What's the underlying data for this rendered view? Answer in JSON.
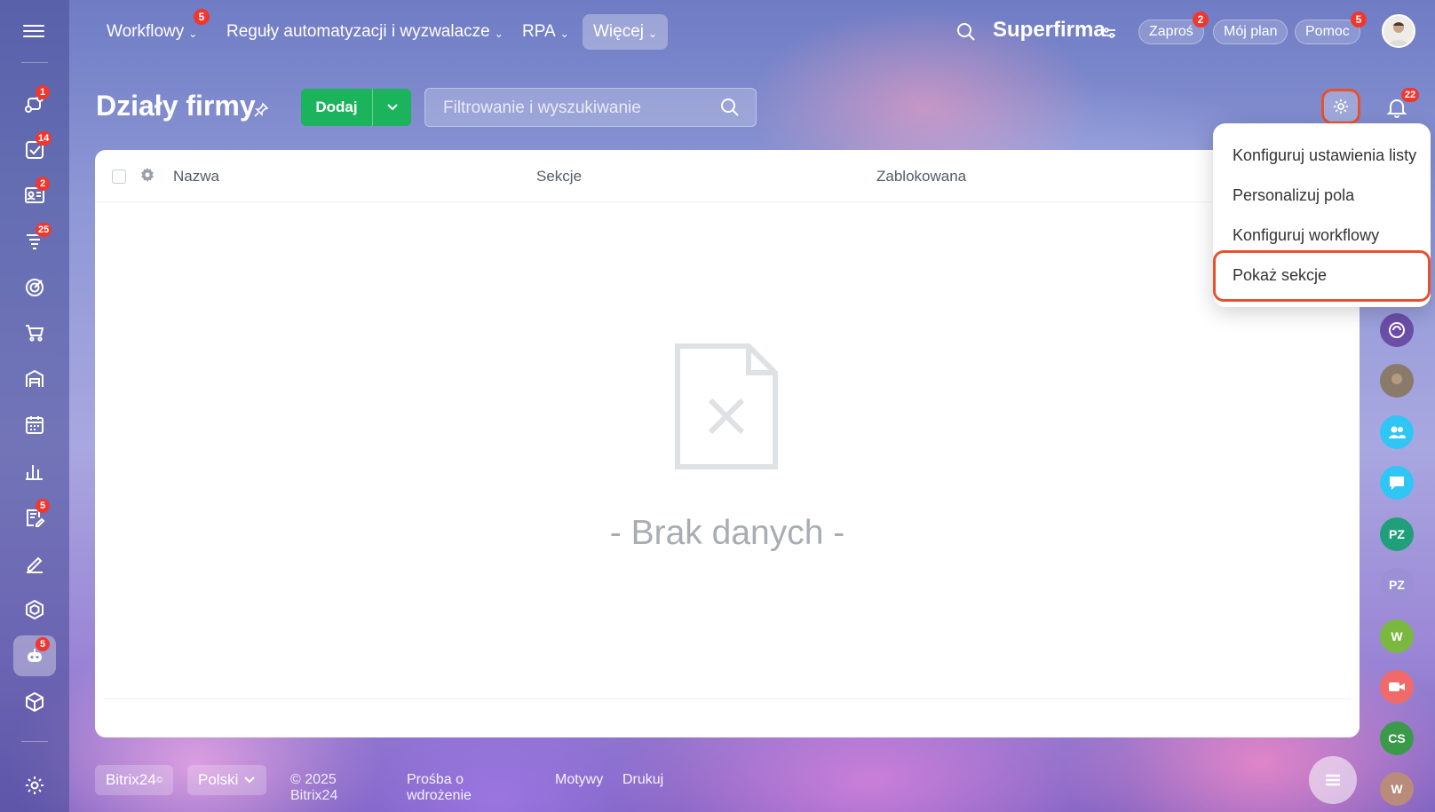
{
  "topnav": {
    "items": [
      {
        "label": "Workflowy",
        "badge": "5"
      },
      {
        "label": "Reguły automatyzacji i wyzwalacze"
      },
      {
        "label": "RPA"
      },
      {
        "label": "Więcej"
      }
    ],
    "brand": "Superfirma",
    "invite": {
      "label": "Zaproś",
      "badge": "2"
    },
    "plan": {
      "label": "Mój plan"
    },
    "help": {
      "label": "Pomoc",
      "badge": "5"
    }
  },
  "sidebar": {
    "items": [
      {
        "icon": "workflow-icon",
        "badge": "1"
      },
      {
        "icon": "tasks-icon",
        "badge": "14"
      },
      {
        "icon": "contact-card-icon",
        "badge": "2"
      },
      {
        "icon": "filter-funnel-icon",
        "badge": "25"
      },
      {
        "icon": "target-icon"
      },
      {
        "icon": "cart-icon"
      },
      {
        "icon": "warehouse-icon"
      },
      {
        "icon": "calendar-icon"
      },
      {
        "icon": "bar-chart-icon"
      },
      {
        "icon": "document-edit-icon",
        "badge": "5"
      },
      {
        "icon": "pen-sign-icon"
      },
      {
        "icon": "hexagon-icon"
      },
      {
        "icon": "robot-icon",
        "badge": "5"
      },
      {
        "icon": "box-icon"
      },
      {
        "icon": "settings-icon"
      }
    ]
  },
  "page": {
    "title": "Działy firmy",
    "add_label": "Dodaj",
    "filter_placeholder": "Filtrowanie i wyszukiwanie",
    "notifications_badge": "22"
  },
  "table": {
    "columns": [
      "Nazwa",
      "Sekcje",
      "Zablokowana"
    ],
    "empty_text": "- Brak danych -"
  },
  "dropdown": {
    "items": [
      "Konfiguruj ustawienia listy",
      "Personalizuj pola",
      "Konfiguruj workflowy",
      "Pokaż sekcje"
    ]
  },
  "footer": {
    "brand": "Bitrix24",
    "brand_mark": "©",
    "language": "Polski",
    "copyright": "© 2025 Bitrix24",
    "links": [
      "Prośba o wdrożenie",
      "Motywy",
      "Drukuj"
    ]
  },
  "rail": {
    "items": [
      {
        "icon": "copilot-icon",
        "color": "#6b4ea8"
      },
      {
        "icon": "group-photo-icon",
        "color": "#8a7a6a"
      },
      {
        "icon": "group-icon",
        "color": "#2fc6f6"
      },
      {
        "icon": "chat-icon",
        "color": "#2fc6f6"
      },
      {
        "initials": "PZ",
        "color": "#1fa07a"
      },
      {
        "initials": "PZ",
        "color": "#9b8fd6"
      },
      {
        "initials": "W",
        "color": "#7ab83f"
      },
      {
        "icon": "video-icon",
        "color": "#f06a6a"
      },
      {
        "initials": "CS",
        "color": "#3a9a4a"
      },
      {
        "initials": "W",
        "color": "#b88b7a"
      }
    ]
  },
  "colors": {
    "accent_green": "#1bb35c",
    "badge_red": "#f0372e",
    "highlight_orange": "#e8512d"
  }
}
